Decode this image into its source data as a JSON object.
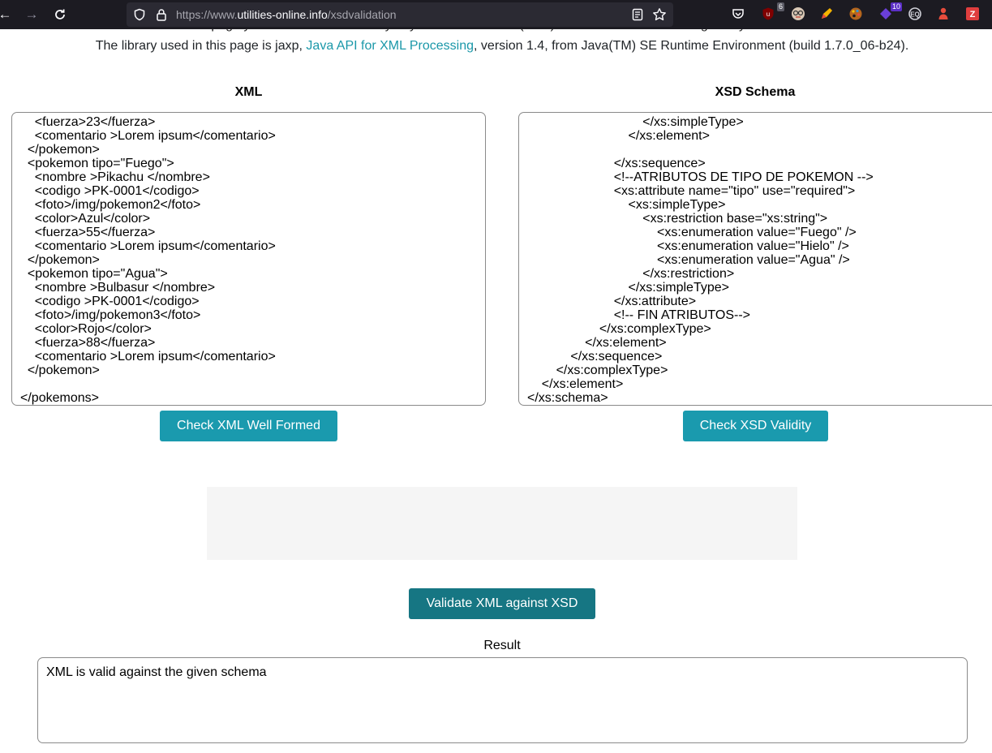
{
  "browser": {
    "url_prefix": "https://www.",
    "url_host": "utilities-online.info",
    "url_path": "/xsdvalidation",
    "extensions": [
      {
        "icon": "ublock-icon",
        "badge": "6"
      },
      {
        "icon": "glasses-icon",
        "badge": ""
      },
      {
        "icon": "pen-icon",
        "badge": ""
      },
      {
        "icon": "palette-icon",
        "badge": ""
      },
      {
        "icon": "diamond-icon",
        "badge": "10"
      },
      {
        "icon": "eq-icon",
        "badge": ""
      },
      {
        "icon": "person-icon",
        "badge": ""
      },
      {
        "icon": "zotero-icon",
        "badge": ""
      }
    ]
  },
  "page": {
    "intro_clipped": "In this page you can check the validity of your XML Schema (XSD) file. And check an XML against your Schema.",
    "intro_before": "The library used in this page is jaxp, ",
    "intro_link": "Java API for XML Processing",
    "intro_after": ", version 1.4, from Java(TM) SE Runtime Environment (build 1.7.0_06-b24).",
    "xml_title": "XML",
    "xsd_title": "XSD Schema",
    "xml_content": "    <fuerza>23</fuerza>\n    <comentario >Lorem ipsum</comentario>\n  </pokemon>\n  <pokemon tipo=\"Fuego\">\n    <nombre >Pikachu </nombre>\n    <codigo >PK-0001</codigo>\n    <foto>/img/pokemon2</foto>\n    <color>Azul</color>\n    <fuerza>55</fuerza>\n    <comentario >Lorem ipsum</comentario>\n  </pokemon>\n  <pokemon tipo=\"Agua\">\n    <nombre >Bulbasur </nombre>\n    <codigo >PK-0001</codigo>\n    <foto>/img/pokemon3</foto>\n    <color>Rojo</color>\n    <fuerza>88</fuerza>\n    <comentario >Lorem ipsum</comentario>\n  </pokemon>\n\n</pokemons>",
    "xsd_content": "                                </xs:simpleType>\n                            </xs:element>\n\n                        </xs:sequence>\n                        <!--ATRIBUTOS DE TIPO DE POKEMON -->\n                        <xs:attribute name=\"tipo\" use=\"required\">\n                            <xs:simpleType>\n                                <xs:restriction base=\"xs:string\">\n                                    <xs:enumeration value=\"Fuego\" />\n                                    <xs:enumeration value=\"Hielo\" />\n                                    <xs:enumeration value=\"Agua\" />\n                                </xs:restriction>\n                            </xs:simpleType>\n                        </xs:attribute>\n                        <!-- FIN ATRIBUTOS-->\n                    </xs:complexType>\n                </xs:element>\n            </xs:sequence>\n        </xs:complexType>\n    </xs:element>\n</xs:schema>",
    "check_xml_label": "Check XML Well Formed",
    "check_xsd_label": "Check XSD Validity",
    "validate_label": "Validate XML against XSD",
    "result_label": "Result",
    "result_text": "XML is valid against the given schema"
  }
}
